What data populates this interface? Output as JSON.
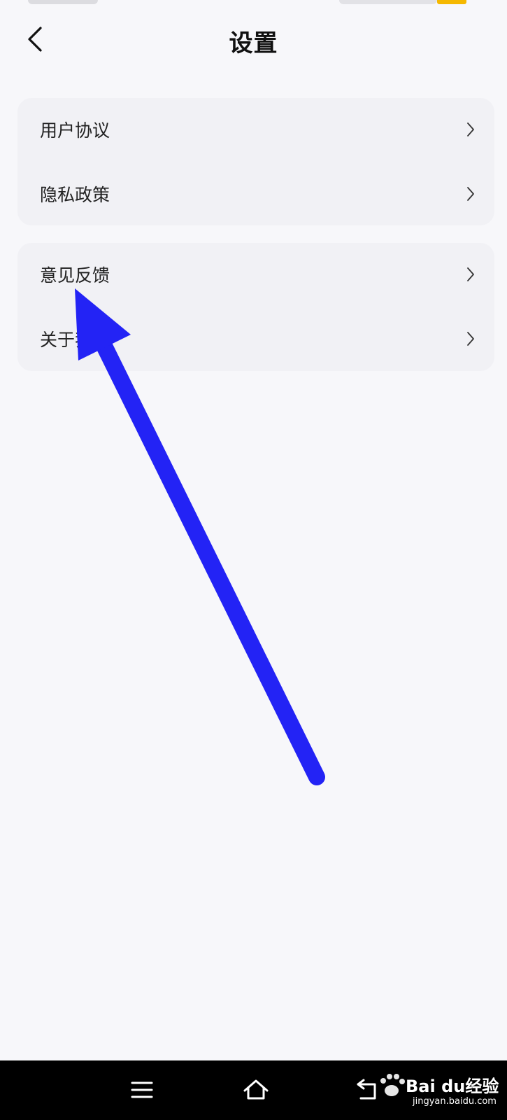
{
  "header": {
    "title": "设置",
    "back_icon": "chevron-left-icon"
  },
  "groups": [
    {
      "items": [
        {
          "label": "用户协议",
          "icon": "chevron-right-icon"
        },
        {
          "label": "隐私政策",
          "icon": "chevron-right-icon"
        }
      ]
    },
    {
      "items": [
        {
          "label": "意见反馈",
          "icon": "chevron-right-icon"
        },
        {
          "label": "关于我们",
          "icon": "chevron-right-icon"
        }
      ]
    }
  ],
  "annotation": {
    "color": "#2323f5"
  },
  "nav": {
    "menu_icon": "menu-icon",
    "home_icon": "home-icon",
    "back_icon": "back-icon"
  },
  "watermark": {
    "brand": "Bai du经验",
    "url": "jingyan.baidu.com"
  },
  "colors": {
    "background": "#f7f7fa",
    "card": "#f1f1f5",
    "battery": "#f5b800",
    "nav_bar": "#000000"
  }
}
